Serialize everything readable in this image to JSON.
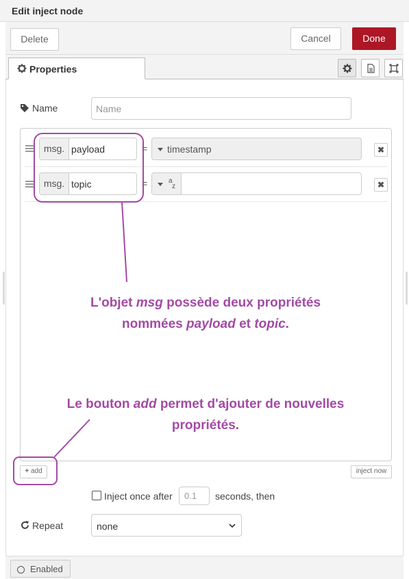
{
  "header": {
    "title": "Edit inject node"
  },
  "actions": {
    "delete": "Delete",
    "cancel": "Cancel",
    "done": "Done"
  },
  "tabs": {
    "properties": "Properties"
  },
  "name_field": {
    "label": "Name",
    "placeholder": "Name"
  },
  "properties": [
    {
      "prefix": "msg.",
      "name": "payload",
      "eq": "=",
      "value": "timestamp",
      "remove": "✖"
    },
    {
      "prefix": "msg.",
      "name": "topic",
      "eq": "=",
      "value": "",
      "remove": "✖"
    }
  ],
  "buttons": {
    "add": "add",
    "inject_now": "inject now"
  },
  "inject_once": {
    "label": "Inject once after",
    "delay": "0.1",
    "suffix": "seconds, then"
  },
  "repeat": {
    "label": "Repeat",
    "selected": "none"
  },
  "footer": {
    "enabled": "Enabled"
  },
  "annotations": {
    "note1": {
      "a": "L'objet ",
      "b": "msg",
      "c": " possède deux propriétés",
      "d": "nommées ",
      "e": "payload",
      "f": " et ",
      "g": "topic",
      "h": "."
    },
    "note2": {
      "a": "Le bouton ",
      "b": "add",
      "c": " permet d'ajouter  de nouvelles",
      "d": "propriétés."
    }
  },
  "colors": {
    "done": "#ad1625",
    "annotation": "#a34aa5"
  }
}
